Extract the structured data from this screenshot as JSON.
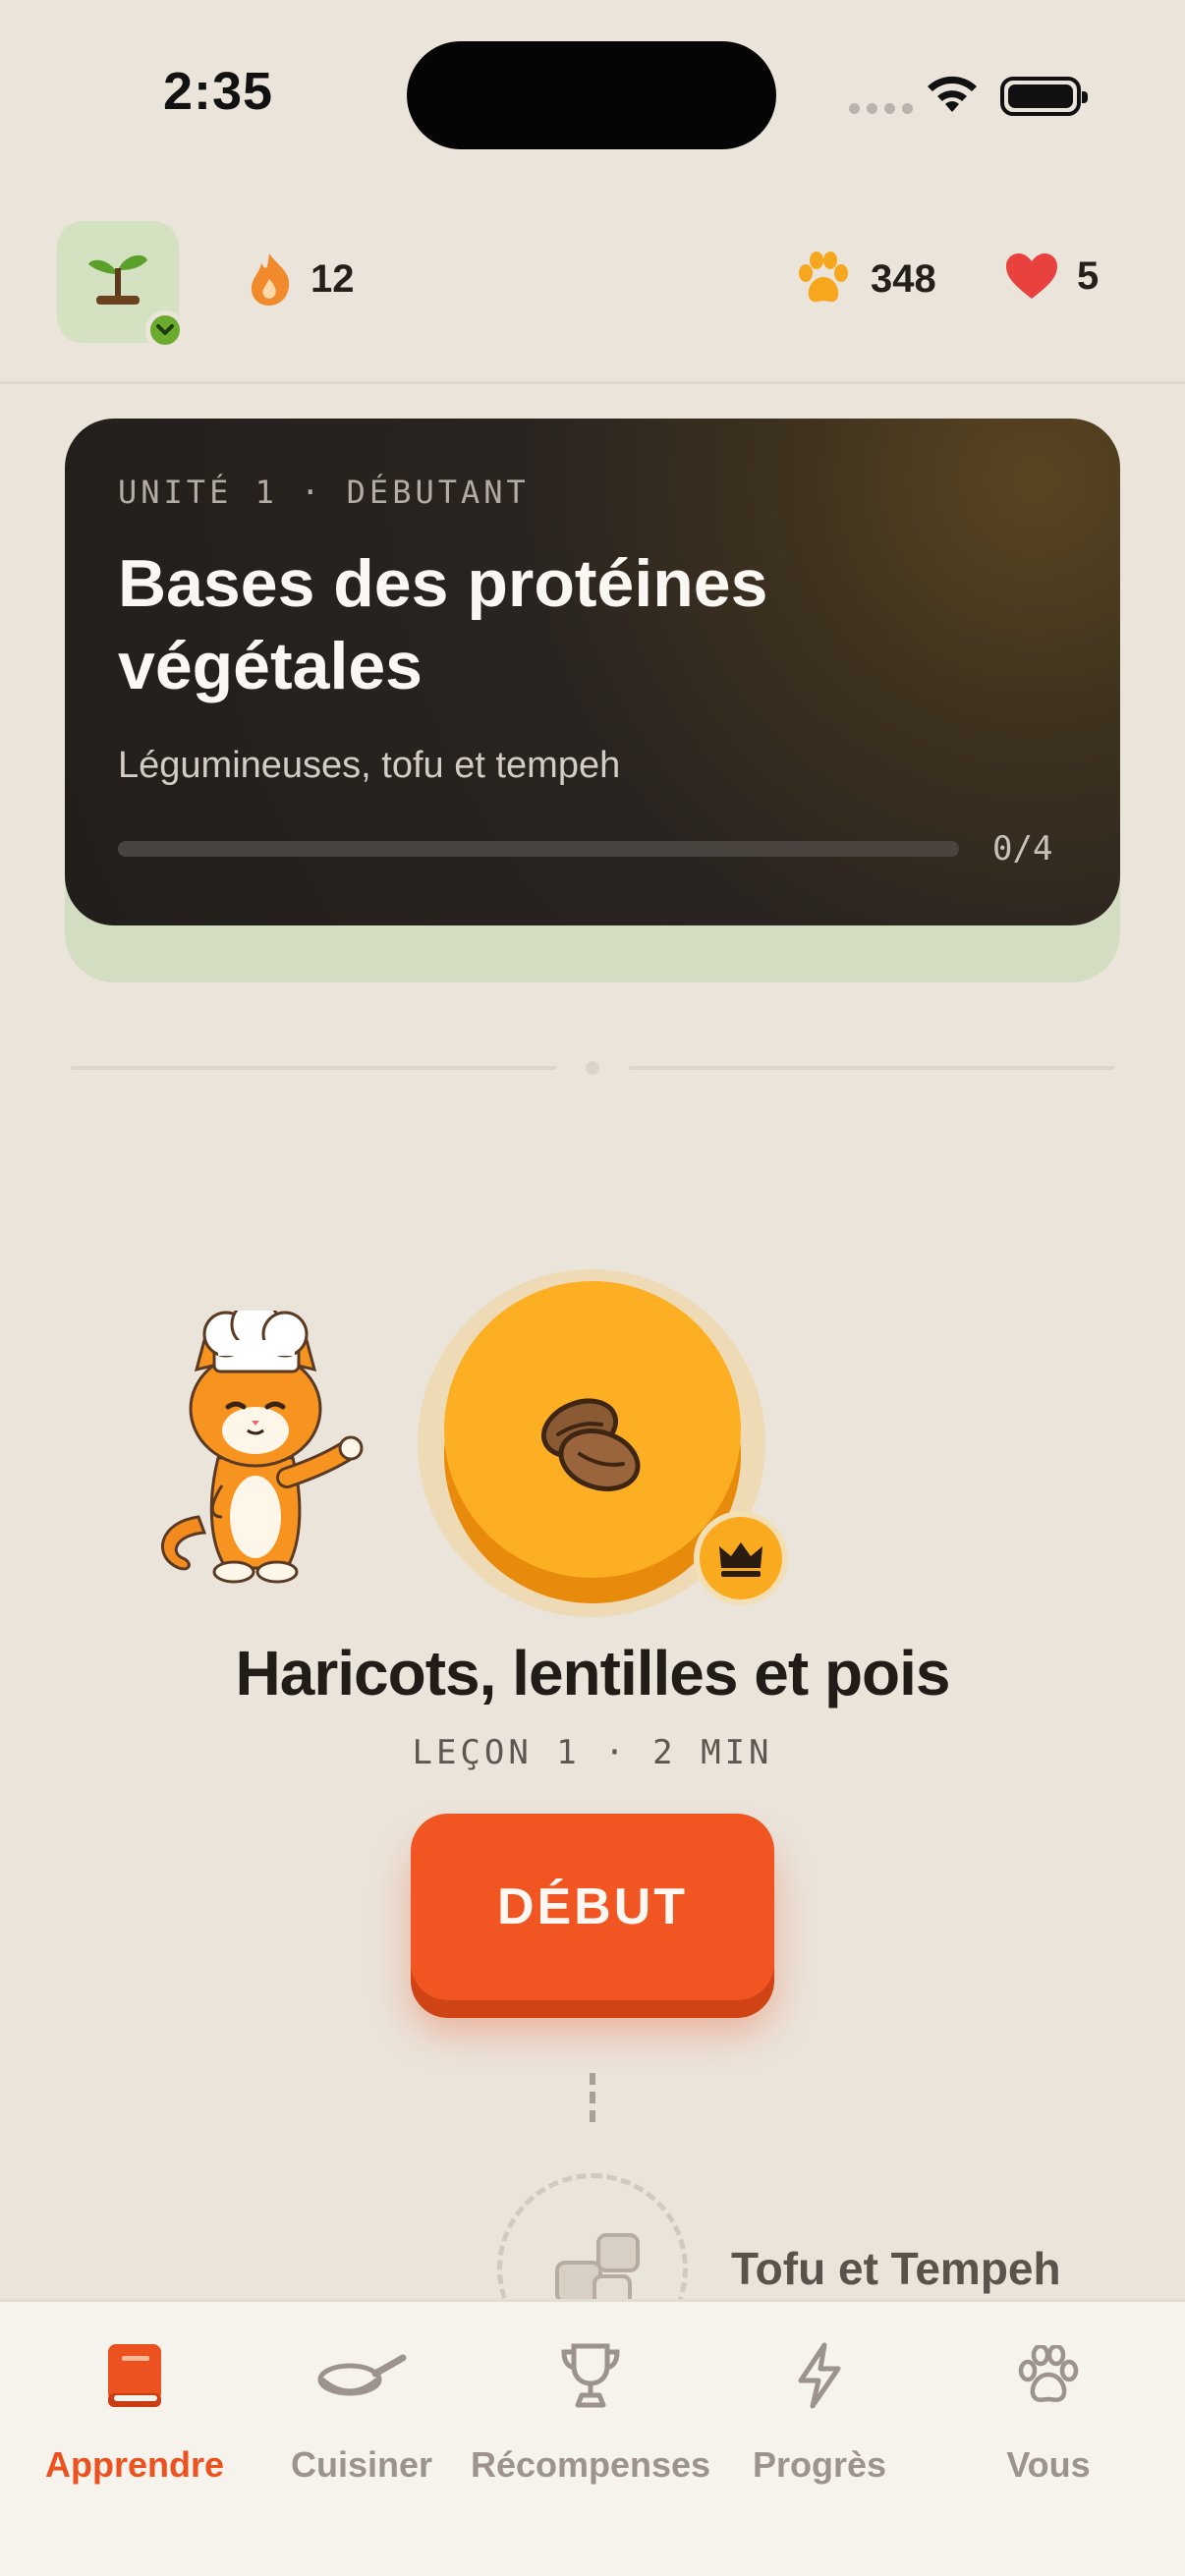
{
  "status_bar": {
    "time": "2:35"
  },
  "header": {
    "streak": "12",
    "paws": "348",
    "hearts": "5"
  },
  "unit_card": {
    "eyebrow": "UNITÉ 1 · DÉBUTANT",
    "title": "Bases des protéines végétales",
    "subtitle": "Légumineuses, tofu et tempeh",
    "progress_text": "0/4",
    "progress_value": 0
  },
  "lesson": {
    "title": "Haricots, lentilles et pois",
    "meta": "LEÇON 1 · 2 MIN",
    "start_label": "DÉBUT"
  },
  "next_lesson": {
    "title": "Tofu et Tempeh"
  },
  "tabs": [
    {
      "label": "Apprendre",
      "icon": "book-icon",
      "active": true
    },
    {
      "label": "Cuisiner",
      "icon": "frying-pan-icon",
      "active": false
    },
    {
      "label": "Récompenses",
      "icon": "trophy-icon",
      "active": false
    },
    {
      "label": "Progrès",
      "icon": "lightning-icon",
      "active": false
    },
    {
      "label": "Vous",
      "icon": "paw-icon",
      "active": false
    }
  ],
  "colors": {
    "accent": "#f05522",
    "node": "#fdaf24",
    "background": "#ebe4db",
    "card": "#221e1b"
  }
}
